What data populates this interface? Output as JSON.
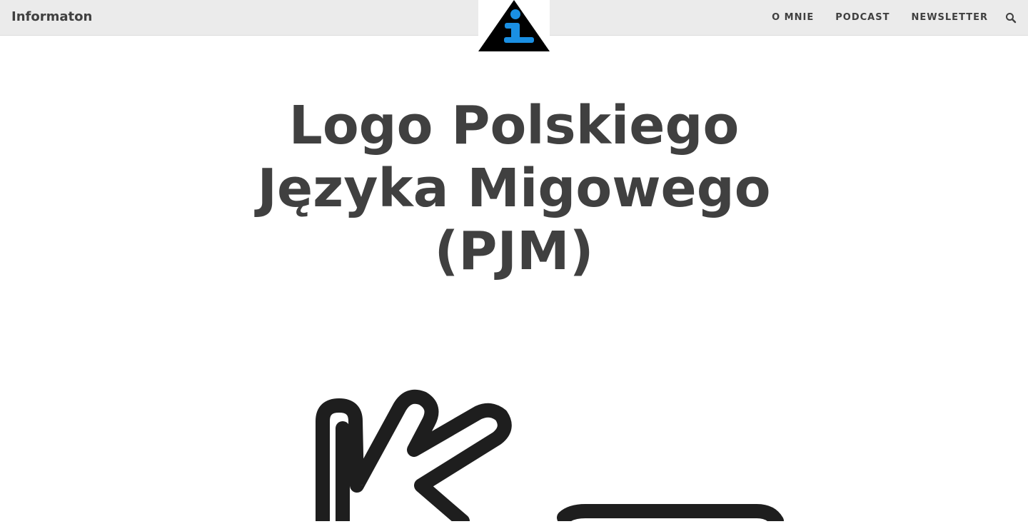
{
  "header": {
    "site_name": "Informaton",
    "logo_icon": "info-triangle-icon",
    "nav_items": [
      "O MNIE",
      "PODCAST",
      "NEWSLETTER"
    ],
    "search_icon": "search-icon"
  },
  "article": {
    "title_lines": [
      "Logo Polskiego",
      "Języka Migowego",
      "(PJM)"
    ]
  },
  "colors": {
    "header_bg": "#ebebeb",
    "text": "#404040",
    "logo_accent": "#1a8fe3",
    "logo_black": "#000000",
    "hand_stroke": "#1e1e1e"
  }
}
